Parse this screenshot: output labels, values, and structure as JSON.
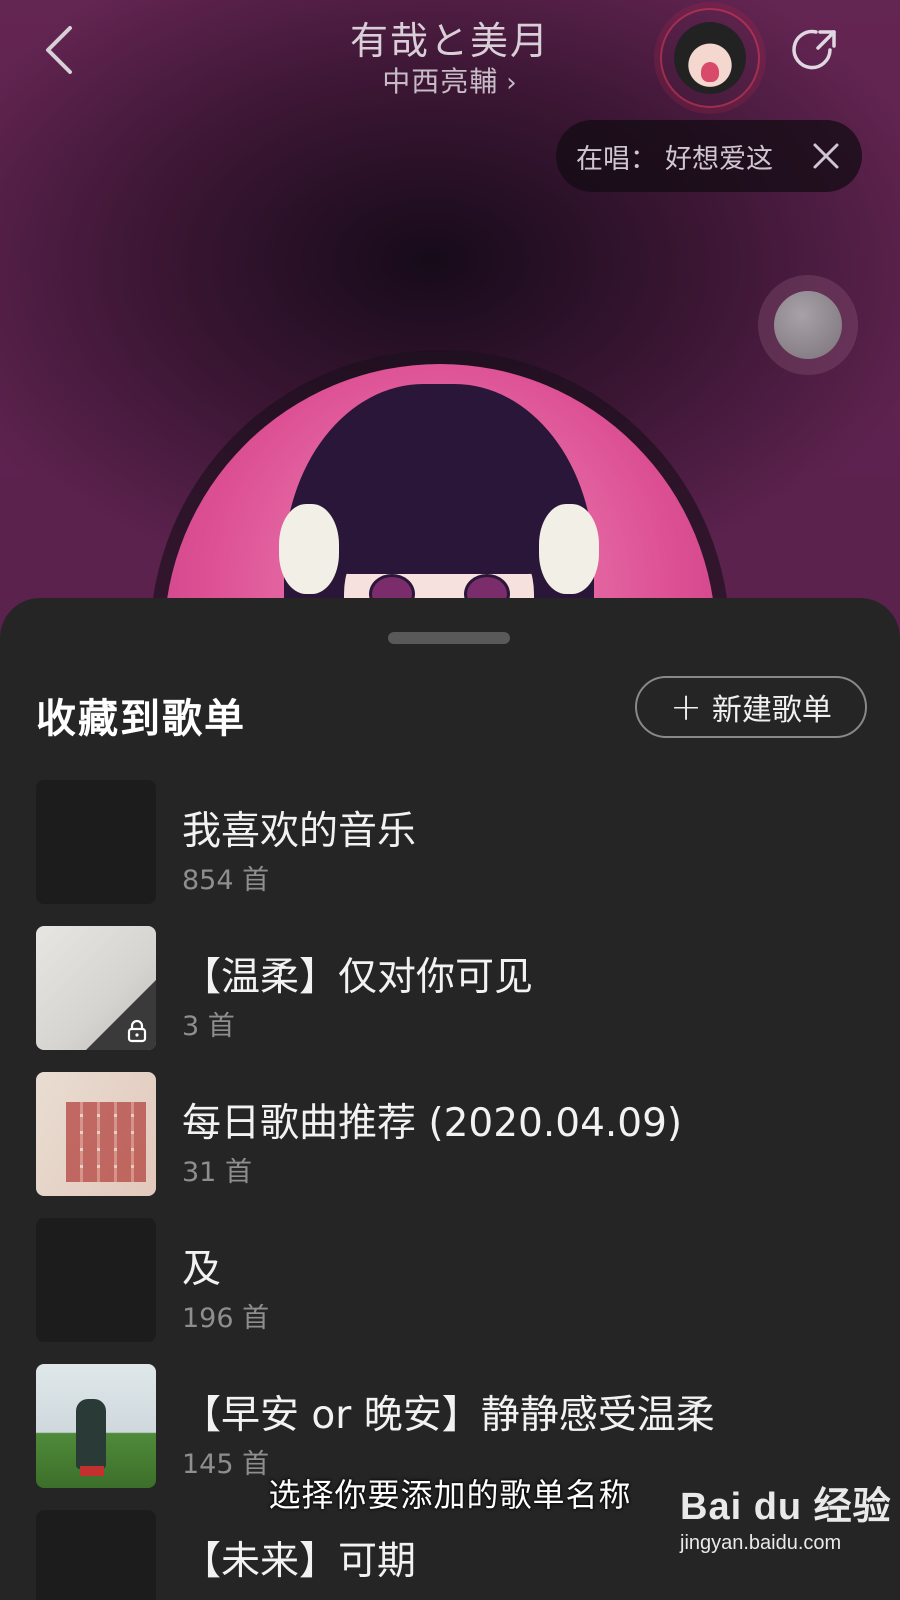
{
  "header": {
    "title": "有哉と美月",
    "artist": "中西亮輔",
    "artist_chevron": "›",
    "now_singing_label": "在唱：",
    "now_singing_song": "好想爱这"
  },
  "sheet": {
    "title": "收藏到歌单",
    "new_playlist_label": "新建歌单",
    "new_playlist_plus": "+"
  },
  "playlists": [
    {
      "name": "我喜欢的音乐",
      "count": "854 首"
    },
    {
      "name": "【温柔】仅对你可见",
      "count": "3 首"
    },
    {
      "name": "每日歌曲推荐 (2020.04.09)",
      "count": "31 首"
    },
    {
      "name": "及",
      "count": "196 首"
    },
    {
      "name": "【早安 or 晚安】静静感受温柔",
      "count": "145 首"
    },
    {
      "name": "【未来】可期",
      "count": ""
    }
  ],
  "overlay": {
    "caption": "选择你要添加的歌单名称",
    "watermark_logo": "Bai du 经验",
    "watermark_url": "jingyan.baidu.com"
  },
  "colors": {
    "sheet_bg": "#262526",
    "accent_ring": "#e63c5a"
  }
}
